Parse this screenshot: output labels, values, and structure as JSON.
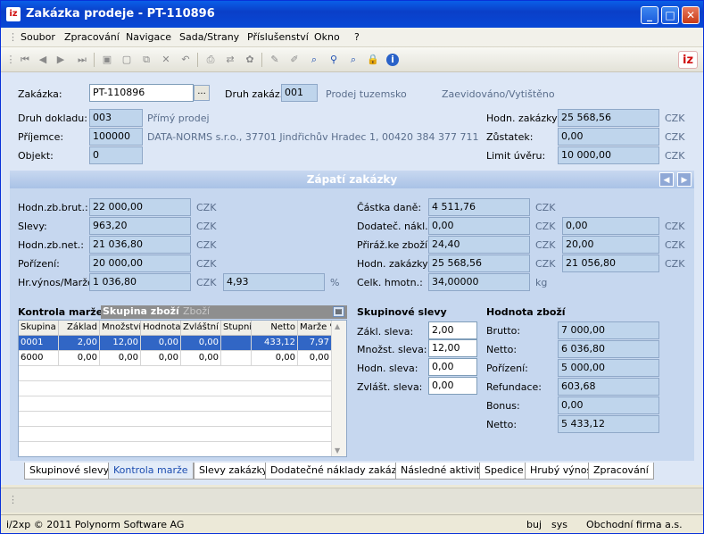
{
  "window": {
    "title": "Zakázka prodeje - PT-110896",
    "logo": "iz"
  },
  "menu": [
    "Soubor",
    "Zpracování",
    "Navigace",
    "Sada/Strany",
    "Příslušenství",
    "Okno",
    "?"
  ],
  "toolbar_icons": [
    "first-icon",
    "prev-icon",
    "next-icon",
    "last-icon",
    "save-icon",
    "new-icon",
    "copy-icon",
    "delete-icon",
    "undo-icon",
    "print-icon",
    "export-icon",
    "settings-icon",
    "edit-icon",
    "edit2-icon",
    "search-icon",
    "find-icon",
    "zoom-icon",
    "lock-icon",
    "info-icon"
  ],
  "header": {
    "zakazka_label": "Zakázka:",
    "zakazka_value": "PT-110896",
    "lookup_label": "...",
    "druh_zakaz_label": "Druh zakáz.:",
    "druh_zakaz_value": "001",
    "druh_zakaz_text": "Prodej tuzemsko",
    "status_text": "Zaevidováno/Vytištěno",
    "druh_dokladu_label": "Druh dokladu:",
    "druh_dokladu_value": "003",
    "druh_dokladu_text": "Přímý prodej",
    "prijemce_label": "Příjemce:",
    "prijemce_value": "100000",
    "prijemce_text": "DATA-NORMS s.r.o., 37701 Jindřichův Hradec 1, 00420 384 377 711",
    "objekt_label": "Objekt:",
    "objekt_value": "0",
    "hodn_zakazky_label": "Hodn. zakázky:",
    "hodn_zakazky_value": "25 568,56",
    "zustatek_label": "Zůstatek:",
    "zustatek_value": "0,00",
    "limit_label": "Limit úvěru:",
    "limit_value": "10 000,00",
    "currency": "CZK"
  },
  "panel": {
    "title": "Zápatí zakázky",
    "hodn_brut_label": "Hodn.zb.brut.:",
    "hodn_brut_value": "22 000,00",
    "slevy_label": "Slevy:",
    "slevy_value": "963,20",
    "hodn_net_label": "Hodn.zb.net.:",
    "hodn_net_value": "21 036,80",
    "porizeni_label": "Pořízení:",
    "porizeni_value": "20 000,00",
    "marze_label": "Hr.výnos/Marže:",
    "marze_value": "1 036,80",
    "marze_pct": "4,93",
    "pct_unit": "%",
    "castka_dane_label": "Částka daně:",
    "castka_dane_value": "4 511,76",
    "dodatec_label": "Dodateč. nákl.:",
    "dodatec_value": "0,00",
    "dodatec_value2": "0,00",
    "prirazke_label": "Přiráž.ke zboží:",
    "prirazke_value": "24,40",
    "prirazke_value2": "20,00",
    "hodn_zak_label": "Hodn. zakázky:",
    "hodn_zak_value": "25 568,56",
    "hodn_zak_value2": "21 056,80",
    "hmotn_label": "Celk. hmotn.:",
    "hmotn_value": "34,00000",
    "hmotn_unit": "kg",
    "currency": "CZK"
  },
  "kontrola": {
    "title": "Kontrola marže",
    "group_tab": "Skupina zboží",
    "goods_tab": "Zboží",
    "columns": [
      "Skupina",
      "Základ",
      "Množství",
      "Hodnota",
      "Zvláštní",
      "Stupni",
      "Netto",
      "Marže %"
    ],
    "rows": [
      [
        "0001",
        "2,00",
        "12,00",
        "0,00",
        "0,00",
        "",
        "433,12",
        "7,97"
      ],
      [
        "6000",
        "0,00",
        "0,00",
        "0,00",
        "0,00",
        "",
        "0,00",
        "0,00"
      ]
    ]
  },
  "skup_slevy": {
    "title": "Skupinové slevy",
    "zakl_label": "Zákl. sleva:",
    "zakl_value": "2,00",
    "mnozst_label": "Množst. sleva:",
    "mnozst_value": "12,00",
    "hodn_label": "Hodn. sleva:",
    "hodn_value": "0,00",
    "zvlast_label": "Zvlášt. sleva:",
    "zvlast_value": "0,00"
  },
  "hodnota_zbozi": {
    "title": "Hodnota zboží",
    "brutto_label": "Brutto:",
    "brutto_value": "7 000,00",
    "netto_label": "Netto:",
    "netto_value": "6 036,80",
    "porizeni_label": "Pořízení:",
    "porizeni_value": "5 000,00",
    "refundace_label": "Refundace:",
    "refundace_value": "603,68",
    "bonus_label": "Bonus:",
    "bonus_value": "0,00",
    "netto2_label": "Netto:",
    "netto2_value": "5 433,12"
  },
  "tabs": [
    "Skupinové slevy",
    "Kontrola marže",
    "Slevy zakázky",
    "Dodatečné náklady zakázky",
    "Následné aktivity",
    "Spedice",
    "Hrubý výnos",
    "Zpracování"
  ],
  "status": {
    "copyright": "i/2xp © 2011 Polynorm Software AG",
    "s1": "buj",
    "s2": "sys",
    "s3": "Obchodní firma a.s."
  }
}
